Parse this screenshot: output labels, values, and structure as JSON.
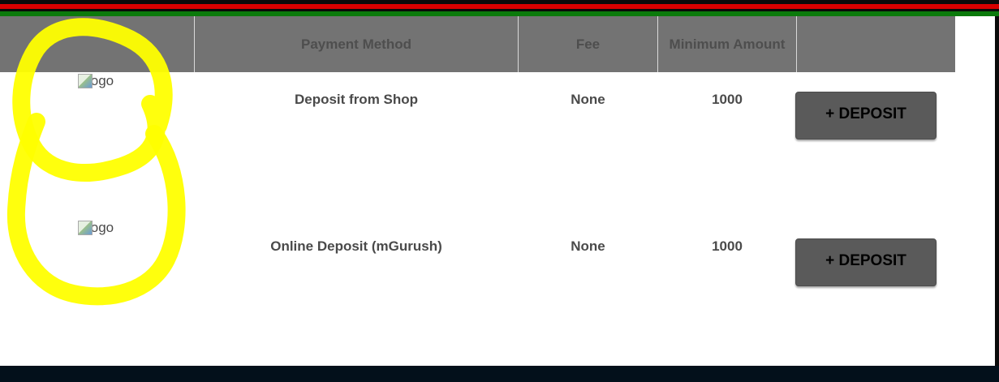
{
  "table": {
    "headers": {
      "logo": "",
      "payment_method": "Payment Method",
      "fee": "Fee",
      "minimum_amount": "Minimum Amount",
      "action": ""
    },
    "rows": [
      {
        "logo_alt": "logo",
        "payment_method": "Deposit from Shop",
        "fee": "None",
        "minimum_amount": "1000",
        "button_label": "+ DEPOSIT"
      },
      {
        "logo_alt": "logo",
        "payment_method": "Online Deposit (mGurush)",
        "fee": "None",
        "minimum_amount": "1000",
        "button_label": "+ DEPOSIT"
      }
    ]
  },
  "colors": {
    "header_bg": "#737373",
    "button_bg": "#5a5a5a",
    "flag_stripes": [
      "#0a0a0a",
      "#d80000",
      "#0a0a0a",
      "#0b7a0b"
    ],
    "annotation_highlight": "#ffff00"
  }
}
